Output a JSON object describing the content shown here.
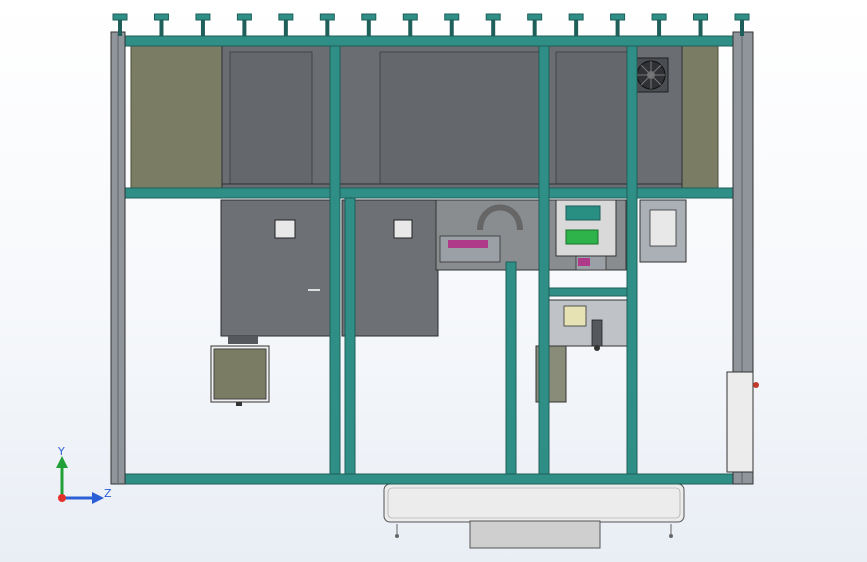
{
  "viewport": {
    "background": "#f3f6fa"
  },
  "colors": {
    "frame_profile": "#2f8f86",
    "frame_dark": "#1f5f5a",
    "post_gray": "#8f959b",
    "panel_olive": "#7a7d63",
    "housing_gray": "#6a6d72",
    "housing_dark": "#55585c",
    "tray_light": "#e6e6e6",
    "component_green": "#2eb34a",
    "component_magenta": "#b03a8a",
    "indicator_red": "#c0392b",
    "axis_x_red": "#e0312b",
    "axis_y_green": "#21a038",
    "axis_z_blue": "#2b5fd6"
  },
  "triad": {
    "y_label": "Y",
    "z_label": "Z"
  },
  "model": {
    "top_fittings_count": 16,
    "components": [
      "outer-frame",
      "left-post",
      "right-post",
      "top-rail",
      "middle-rail",
      "bottom-rail",
      "vertical-profiles",
      "olive-panels",
      "upper-housing",
      "lower-cabinets",
      "mechanism-assembly",
      "green-module",
      "fan-unit",
      "side-box",
      "base-tray",
      "front-door-handles"
    ]
  }
}
